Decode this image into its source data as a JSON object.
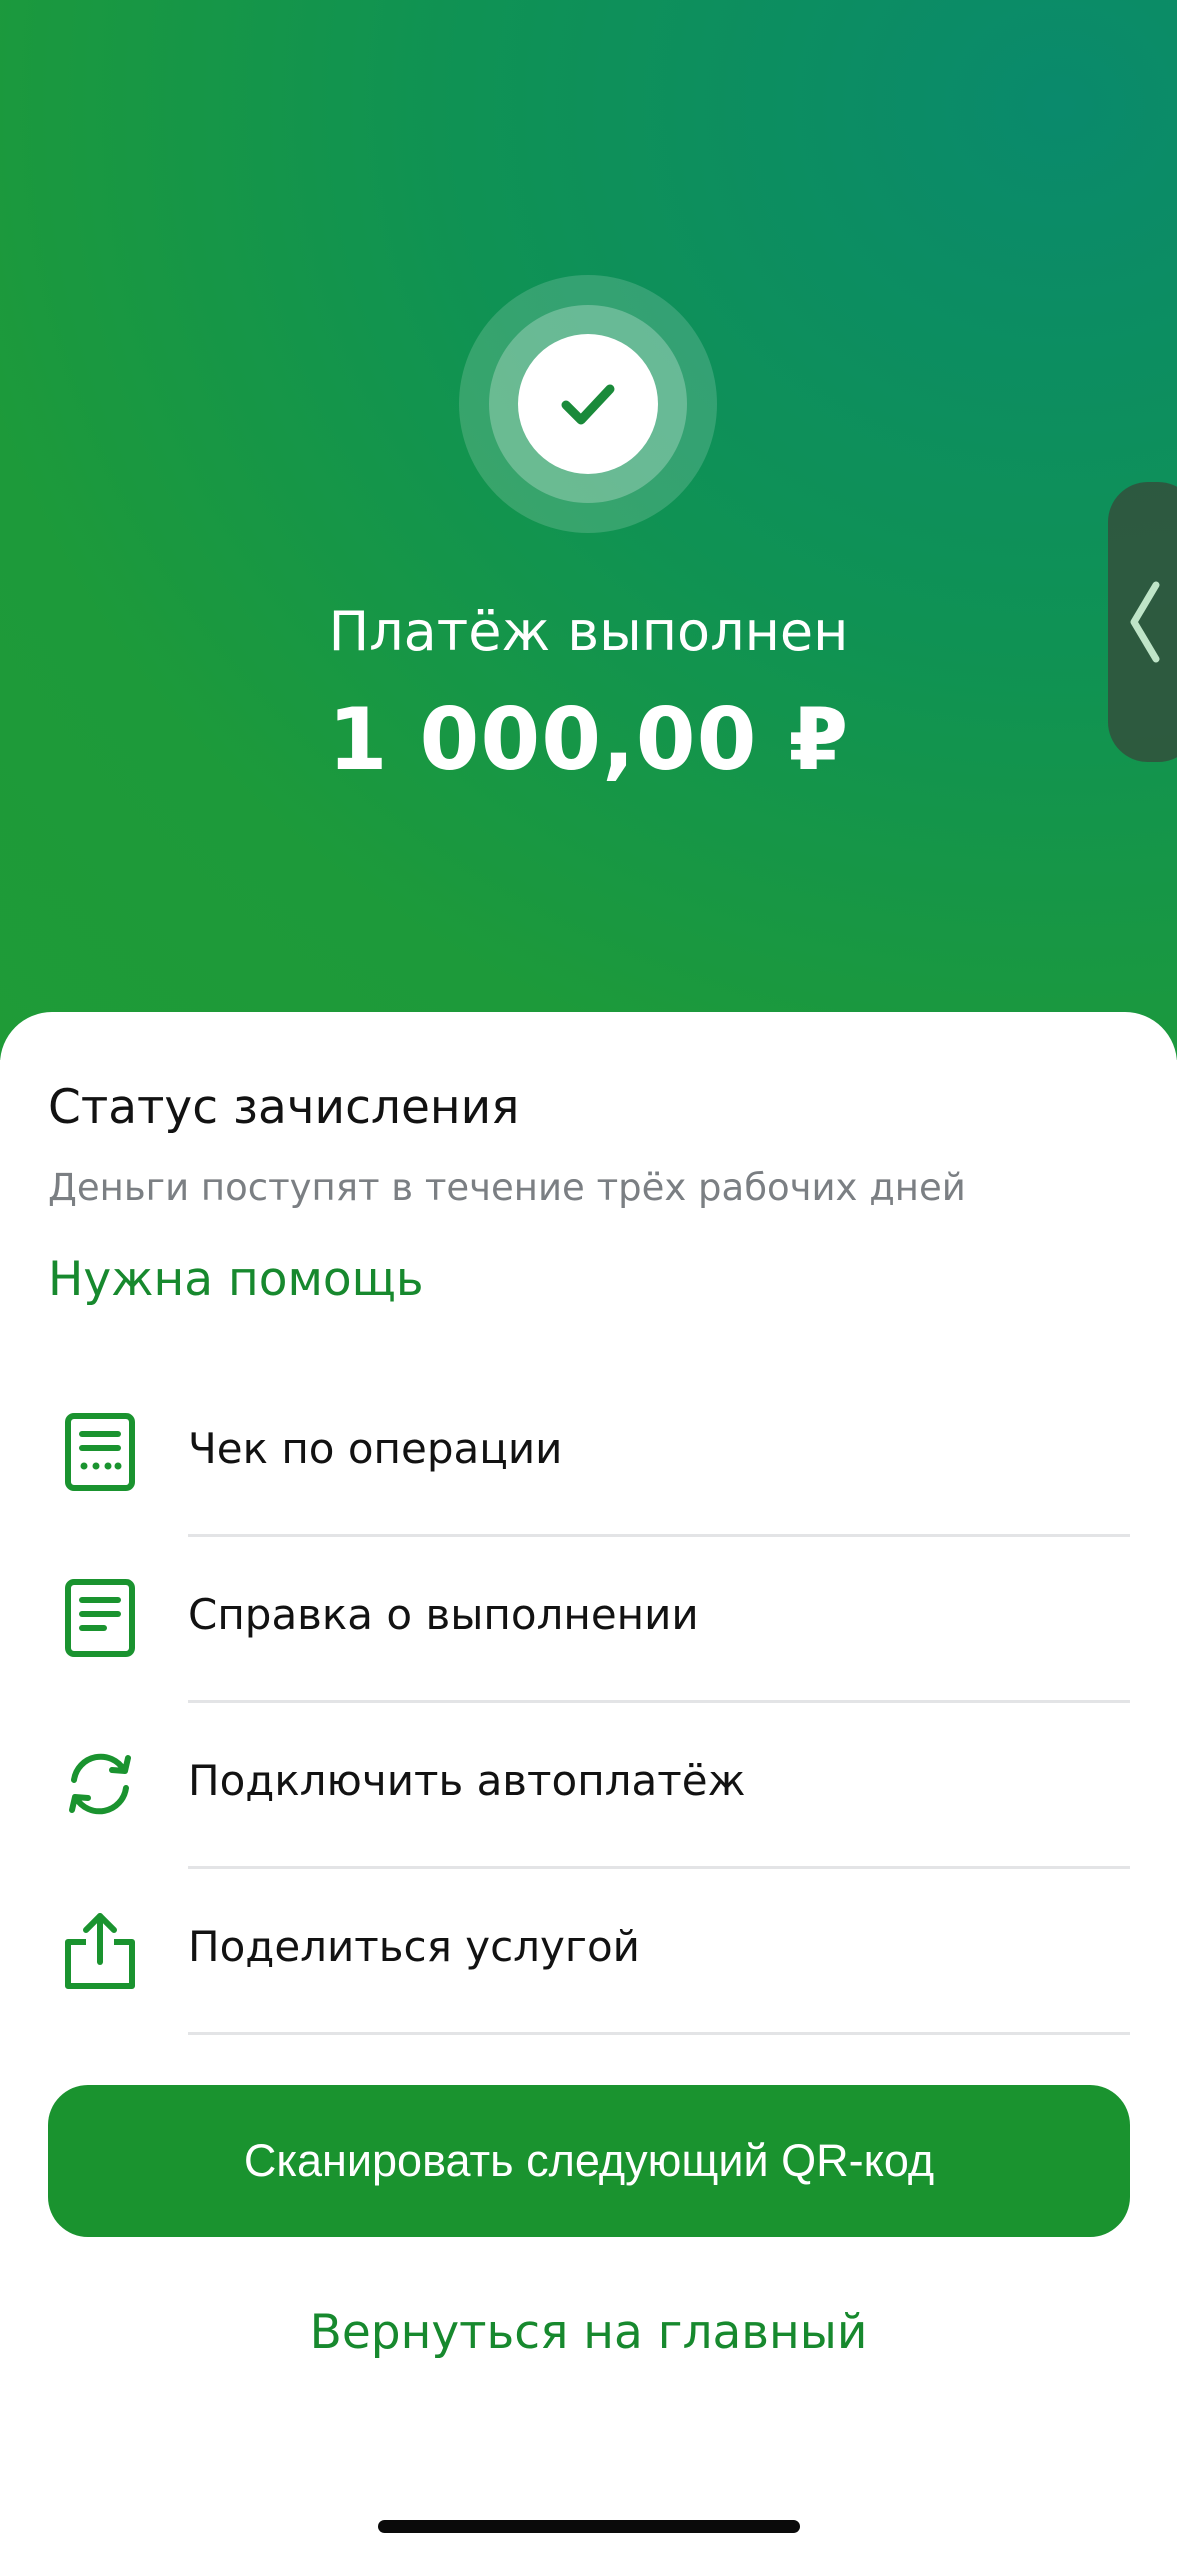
{
  "header": {
    "status_title": "Платёж выполнен",
    "amount": "1 000,00 ₽",
    "status_icon": "check-icon",
    "side_tab_icon": "chevron-left-icon"
  },
  "sheet": {
    "title": "Статус зачисления",
    "subtitle": "Деньги поступят в течение трёх рабочих дней",
    "help_link": "Нужна помощь",
    "actions": [
      {
        "label": "Чек по операции",
        "icon": "receipt-icon"
      },
      {
        "label": "Справка о выполнении",
        "icon": "document-icon"
      },
      {
        "label": "Подключить автоплатёж",
        "icon": "refresh-icon"
      },
      {
        "label": "Поделиться услугой",
        "icon": "share-icon"
      }
    ]
  },
  "buttons": {
    "scan_next": "Сканировать следующий QR-код",
    "back_home": "Вернуться на главный"
  },
  "colors": {
    "brand_green": "#1a932f",
    "link_green": "#17892e",
    "header_gradient_start": "#1f9b37",
    "header_gradient_end": "#0a8a6c"
  }
}
